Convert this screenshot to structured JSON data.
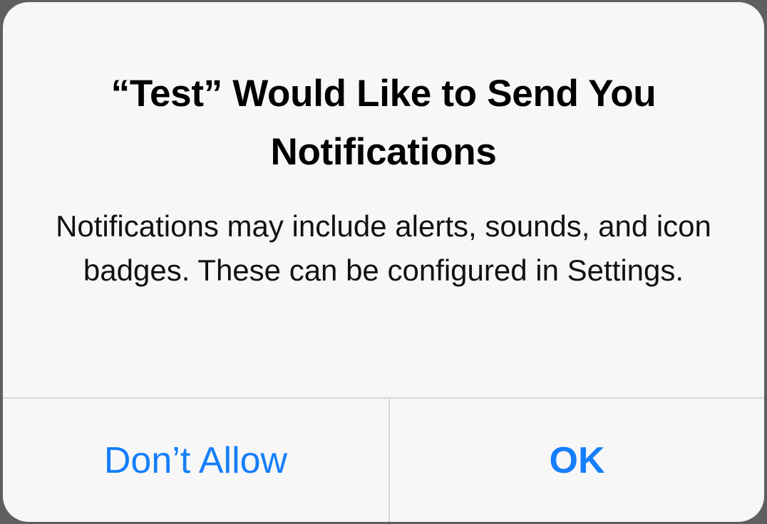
{
  "alert": {
    "title": "“Test” Would Like to Send You Notifications",
    "message": "Notifications may include alerts, sounds, and icon badges. These can be configured in Settings.",
    "buttons": [
      {
        "label": "Don’t Allow"
      },
      {
        "label": "OK"
      }
    ]
  },
  "colors": {
    "accent": "#157efb",
    "background": "#f7f7f7",
    "divider": "#d8d8d8"
  }
}
